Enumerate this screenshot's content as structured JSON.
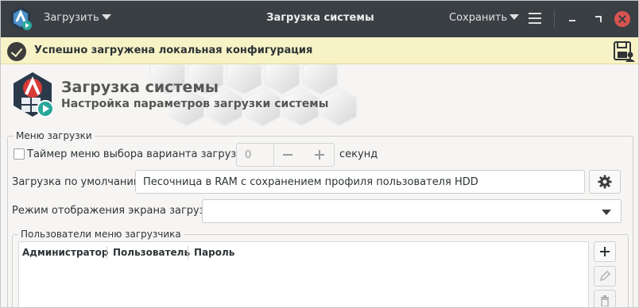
{
  "titlebar": {
    "load_menu": "Загрузить",
    "title": "Загрузка системы",
    "save_menu": "Сохранить"
  },
  "infobar": {
    "message": "Успешно загружена локальная конфигурация"
  },
  "header": {
    "title": "Загрузка системы",
    "subtitle": "Настройка параметров загрузки системы"
  },
  "boot_menu": {
    "legend": "Меню загрузки",
    "timer_label": "Таймер меню выбора варианта загрузки:",
    "timer_checked": false,
    "timer_value": "0",
    "timer_unit": "секунд",
    "default_label": "Загрузка по умолчанию:",
    "default_value": "Песочница в RAM с сохранением профиля пользователя HDD",
    "display_mode_label": "Режим отображения экрана загрузки:",
    "display_mode_value": ""
  },
  "users": {
    "legend": "Пользователи меню загрузчика",
    "columns": [
      "Администратор",
      "Пользователь",
      "Пароль"
    ],
    "rows": []
  },
  "icons": {
    "app": "boot-app-icon",
    "check": "check-circle-icon",
    "save_profile": "save-profile-icon",
    "gear": "gear-icon",
    "add": "plus-icon",
    "edit": "pencil-icon",
    "delete": "trash-icon"
  },
  "colors": {
    "titlebar_bg": "#3a3f44",
    "infobar_bg": "#f7f3c6",
    "close_button": "#d9534f",
    "accent_teal": "#2aa79b",
    "accent_red": "#d83b35"
  }
}
